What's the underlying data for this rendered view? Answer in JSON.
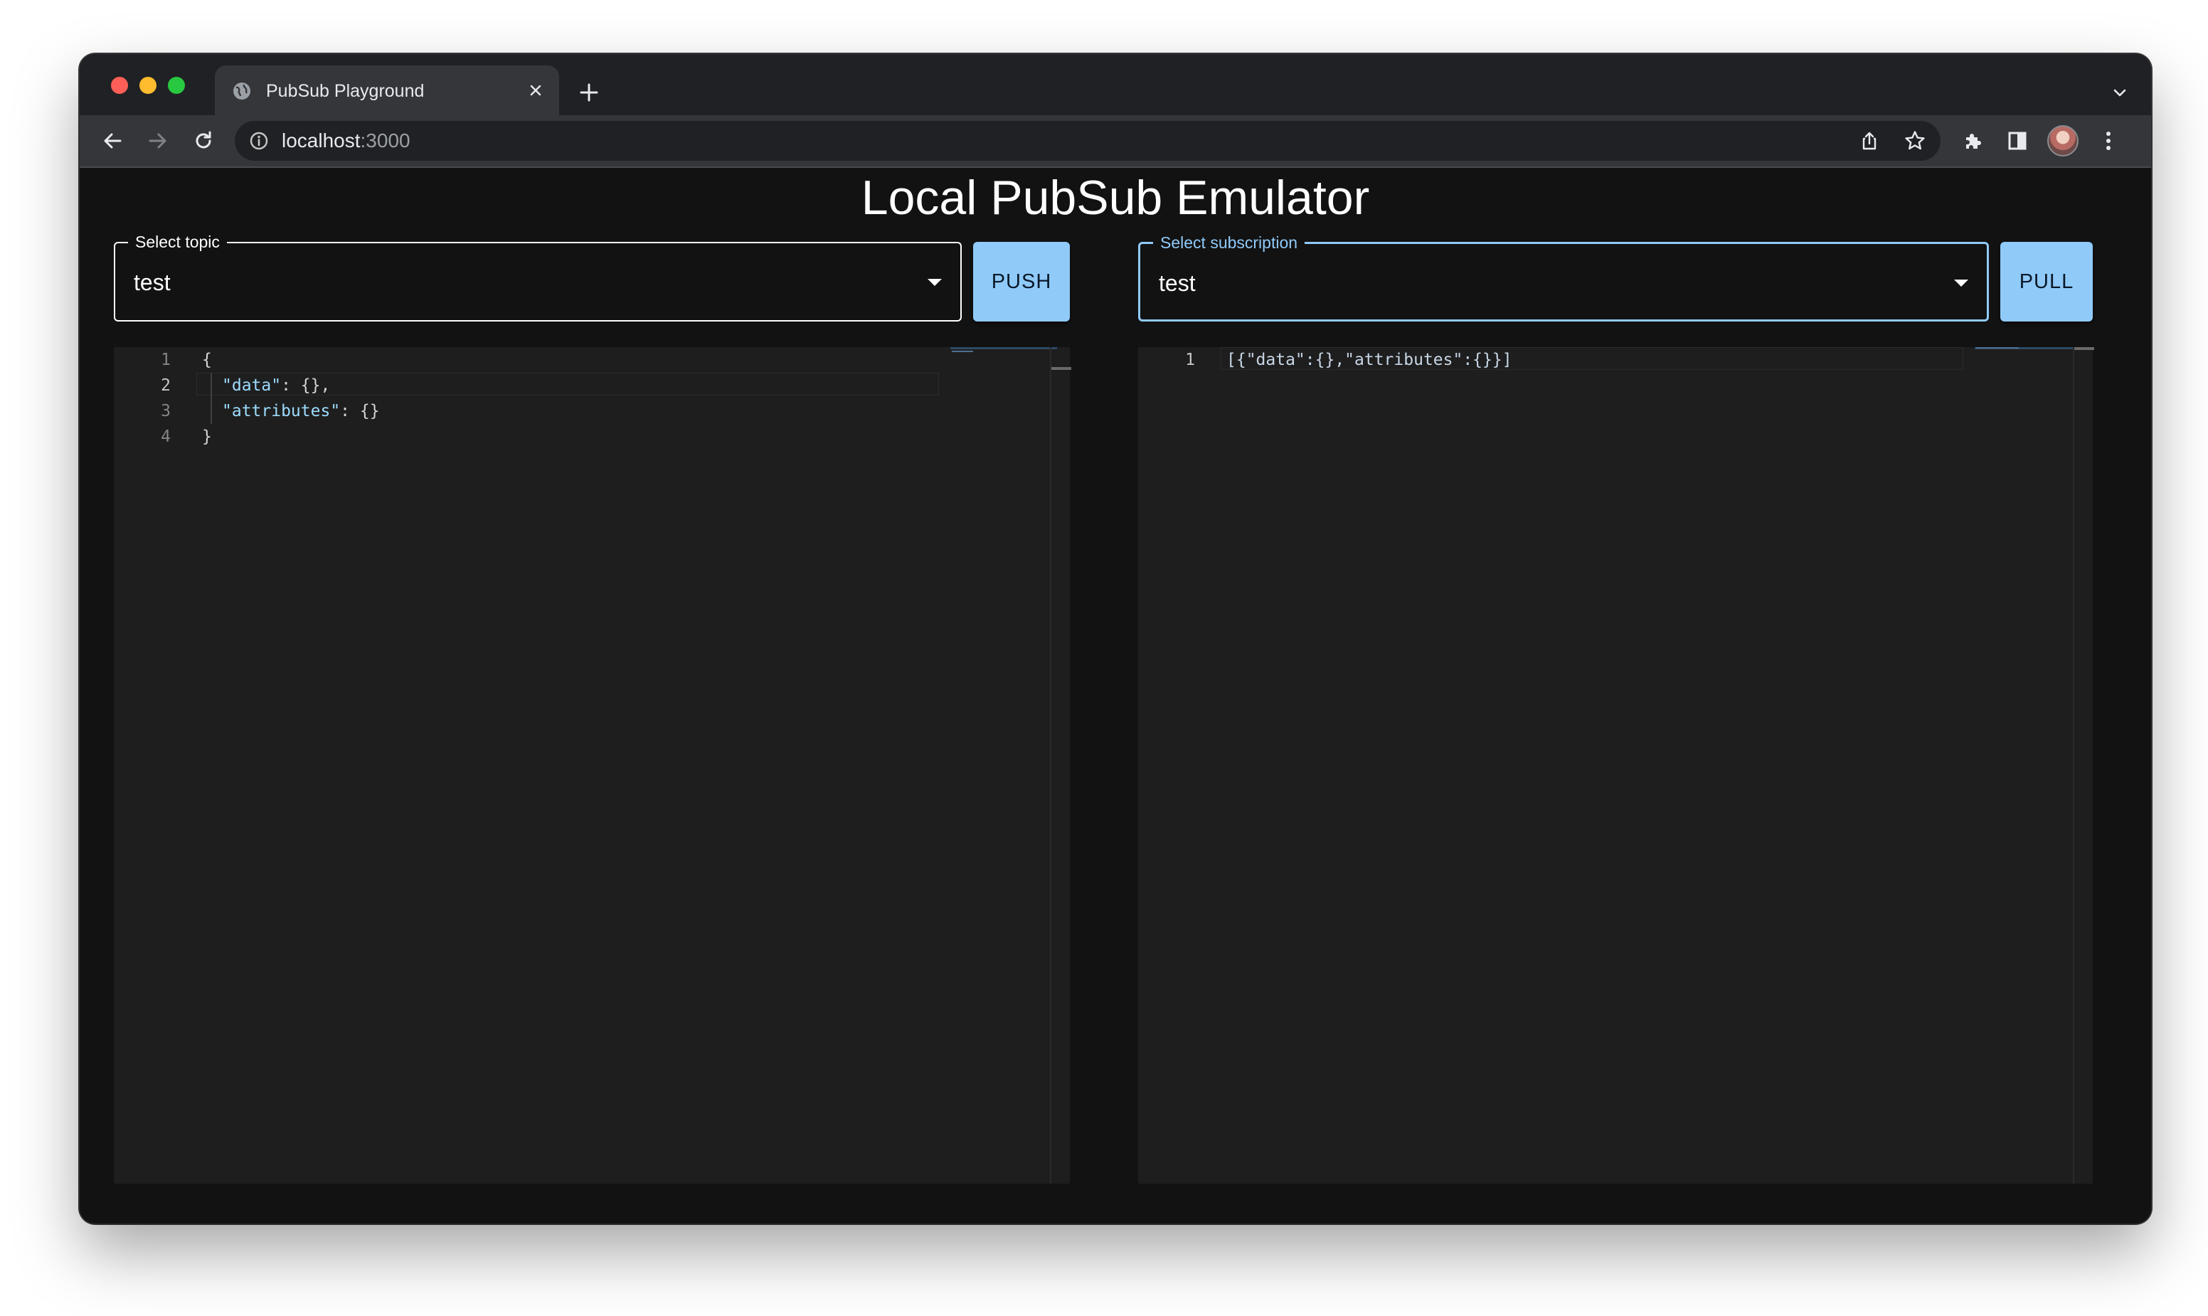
{
  "browser": {
    "tab_title": "PubSub Playground",
    "url_host": "localhost",
    "url_port": ":3000",
    "icons": [
      "globe-icon",
      "close-icon",
      "plus-icon",
      "chevron-down-icon",
      "back-arrow-icon",
      "forward-arrow-icon",
      "reload-icon",
      "info-icon",
      "share-icon",
      "star-icon",
      "puzzle-icon",
      "side-panel-icon",
      "avatar",
      "kebab-menu-icon"
    ]
  },
  "page": {
    "title": "Local PubSub Emulator"
  },
  "topic": {
    "label": "Select topic",
    "value": "test",
    "button": "PUSH"
  },
  "subscription": {
    "label": "Select subscription",
    "value": "test",
    "button": "PULL"
  },
  "editor_push": {
    "lines": [
      {
        "number": "1",
        "text": "{"
      },
      {
        "number": "2",
        "key": "\"data\"",
        "rest": ": {},"
      },
      {
        "number": "3",
        "key": "\"attributes\"",
        "rest": ": {}"
      },
      {
        "number": "4",
        "text": "}"
      }
    ]
  },
  "editor_pull": {
    "lines": [
      {
        "number": "1",
        "text": "[{\"data\":{},\"attributes\":{}}]"
      }
    ]
  },
  "colors": {
    "accent": "#90caf9",
    "background": "#121212",
    "editor_background": "#1e1e1e",
    "string_token": "#9cdcfe"
  }
}
